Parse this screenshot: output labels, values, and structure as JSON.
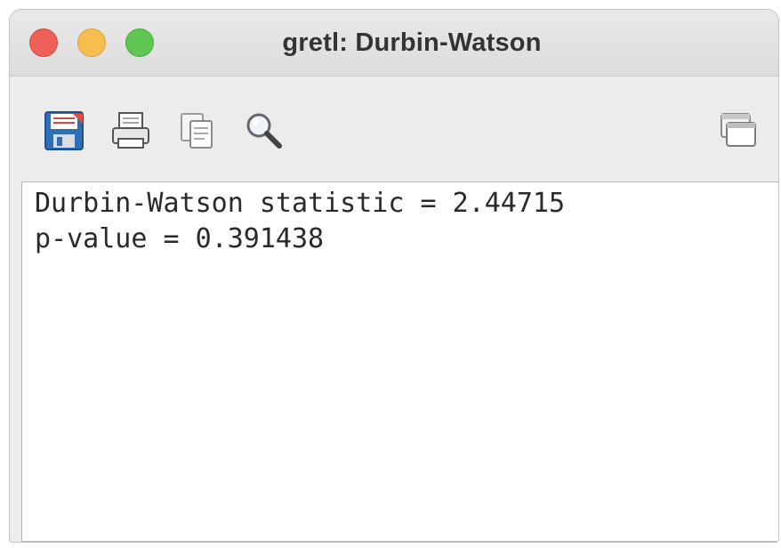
{
  "window": {
    "title": "gretl: Durbin-Watson",
    "controls": [
      "close",
      "minimize",
      "zoom"
    ]
  },
  "toolbar": {
    "buttons": [
      {
        "icon": "save-icon",
        "tooltip": "save"
      },
      {
        "icon": "print-icon",
        "tooltip": "print"
      },
      {
        "icon": "copy-icon",
        "tooltip": "copy"
      },
      {
        "icon": "search-icon",
        "tooltip": "find"
      },
      {
        "icon": "windows-icon",
        "tooltip": "windows"
      }
    ]
  },
  "output": {
    "lines": [
      "Durbin-Watson statistic = 2.44715",
      "p-value = 0.391438"
    ]
  },
  "colors": {
    "close": "#ee5f57",
    "minimize": "#f5be4f",
    "zoom": "#5fc653"
  }
}
